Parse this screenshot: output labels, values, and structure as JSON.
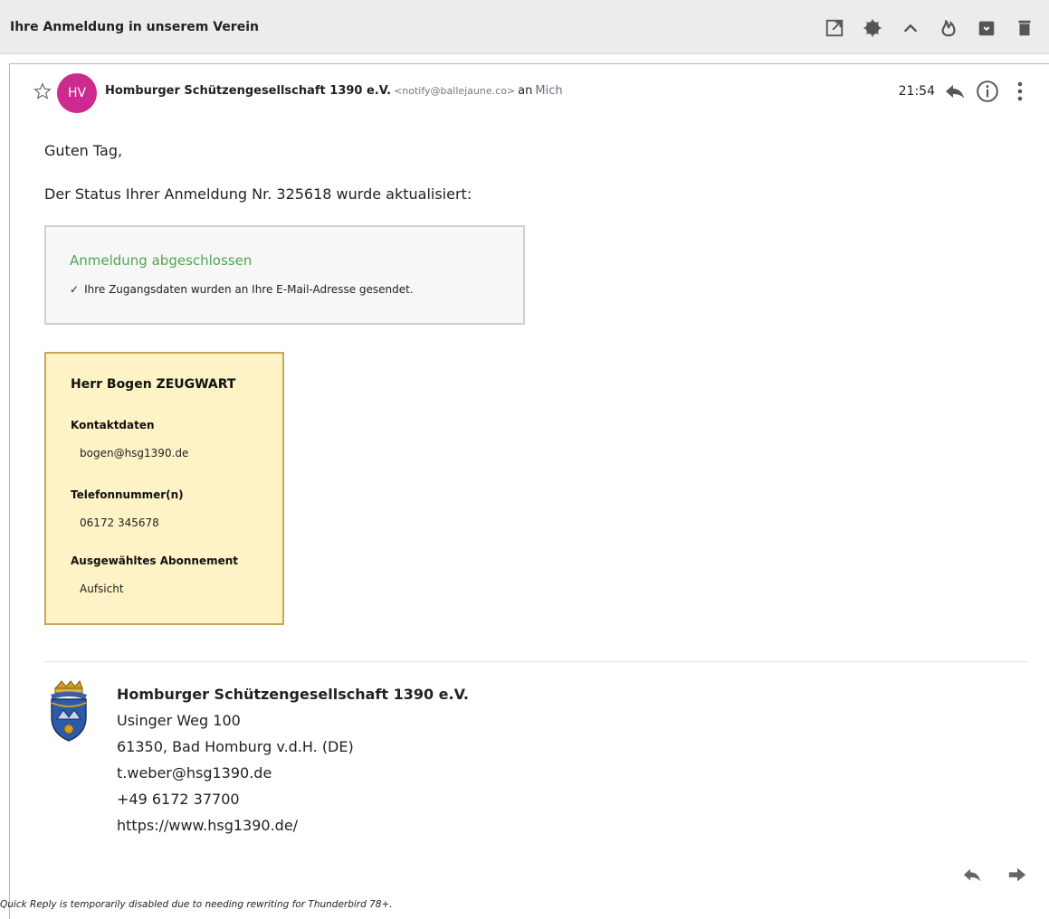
{
  "window": {
    "subject": "Ihre Anmeldung in unserem Verein",
    "toolbar_icons": [
      "open-in-new-icon",
      "settings-icon",
      "collapse-icon",
      "burn-icon",
      "archive-icon",
      "delete-icon"
    ]
  },
  "message": {
    "avatar_initials": "HV",
    "sender_name": "Homburger Schützengesellschaft 1390 e.V.",
    "sender_email": "<notify@ballejaune.co>",
    "recipient_prefix": "an",
    "recipient": "Mich",
    "time": "21:54"
  },
  "body": {
    "greeting": "Guten Tag,",
    "status_line": "Der Status Ihrer Anmeldung Nr. 325618 wurde aktualisiert:",
    "status_box": {
      "title": "Anmeldung abgeschlossen",
      "check_mark": "✓",
      "message": "Ihre Zugangsdaten wurden an Ihre E-Mail-Adresse gesendet."
    },
    "card": {
      "name": "Herr Bogen ZEUGWART",
      "contact_label": "Kontaktdaten",
      "contact_value": "bogen@hsg1390.de",
      "phone_label": "Telefonnummer(n)",
      "phone_value": "06172 345678",
      "subscription_label": "Ausgewähltes Abonnement",
      "subscription_value": "Aufsicht"
    }
  },
  "signature": {
    "name": "Homburger Schützengesellschaft 1390 e.V.",
    "street": "Usinger Weg 100",
    "city": "61350, Bad Homburg v.d.H. (DE)",
    "email": "t.weber@hsg1390.de",
    "phone": "+49 6172 37700",
    "website": "https://www.hsg1390.de/"
  },
  "footer": {
    "quick_reply_note": "Quick Reply is temporarily disabled due to needing rewriting for Thunderbird 78+."
  },
  "colors": {
    "avatar": "#cc2a8f",
    "status_title": "#4ca64c",
    "card_bg": "#fef3c6",
    "card_border": "#c8a659"
  }
}
